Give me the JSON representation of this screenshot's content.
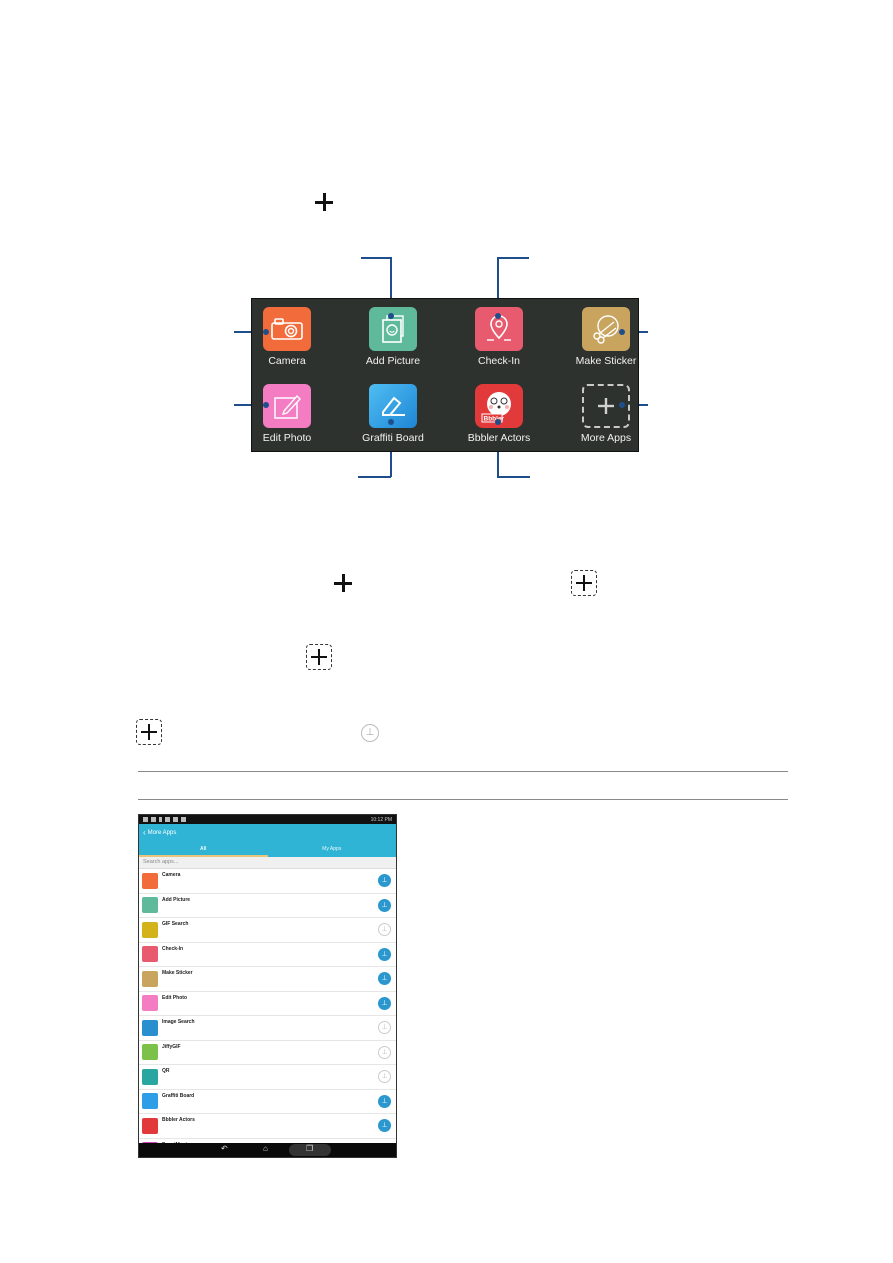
{
  "tray": {
    "items": [
      {
        "label": "Camera",
        "icon": "camera-icon",
        "color": "#f26b3a"
      },
      {
        "label": "Add Picture",
        "icon": "add-picture-icon",
        "color": "#5fb99b"
      },
      {
        "label": "Check-In",
        "icon": "location-pin-icon",
        "color": "#e85a6e"
      },
      {
        "label": "Make Sticker",
        "icon": "scissors-icon",
        "color": "#c9a45e"
      },
      {
        "label": "Edit Photo",
        "icon": "edit-photo-icon",
        "color": "#f47cc3"
      },
      {
        "label": "Graffiti Board",
        "icon": "pen-icon",
        "color": "#2e9ee6"
      },
      {
        "label": "Bbbler Actors",
        "icon": "bbbler-icon",
        "color": "#e23a3a"
      },
      {
        "label": "More Apps",
        "icon": "plus-icon",
        "color": "#c9c9c9"
      }
    ],
    "bbbler_badge": "Bbbler"
  },
  "phone": {
    "status_time": "10:12 PM",
    "title": "More Apps",
    "back_icon": "chevron-left-icon",
    "tabs": [
      {
        "label": "All",
        "active": true
      },
      {
        "label": "My Apps",
        "active": false
      }
    ],
    "search_placeholder": "Search apps...",
    "apps": [
      {
        "label": "Camera",
        "color": "#f26b3a",
        "pinned": true
      },
      {
        "label": "Add Picture",
        "color": "#5fb99b",
        "pinned": true
      },
      {
        "label": "GIF Search",
        "color": "#d4b21a",
        "pinned": false
      },
      {
        "label": "Check-In",
        "color": "#e85a6e",
        "pinned": true
      },
      {
        "label": "Make Sticker",
        "color": "#c9a45e",
        "pinned": true
      },
      {
        "label": "Edit Photo",
        "color": "#f47cc3",
        "pinned": true
      },
      {
        "label": "Image Search",
        "color": "#2a8fcf",
        "pinned": false
      },
      {
        "label": "JiffyGIF",
        "color": "#7cc24a",
        "pinned": false
      },
      {
        "label": "QR",
        "color": "#2aa6a0",
        "pinned": false
      },
      {
        "label": "Graffiti Board",
        "color": "#2e9ee6",
        "pinned": true
      },
      {
        "label": "Bbbler Actors",
        "color": "#e23a3a",
        "pinned": true
      },
      {
        "label": "EventMaster",
        "color": "#d43fbf",
        "pinned": false
      }
    ],
    "nav": {
      "back": "↶",
      "home": "⌂",
      "recent": "❐"
    }
  },
  "glyphs": {
    "pin_on": "⊥",
    "pin_off": "⊥"
  }
}
